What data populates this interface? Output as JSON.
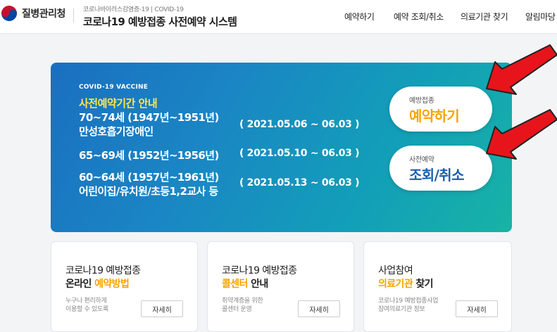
{
  "header": {
    "org_name": "질병관리청",
    "subtitle": "코로나바이러스감염증-19 | COVID-19",
    "title": "코로나19 예방접종 사전예약 시스템",
    "nav": [
      "예약하기",
      "예약 조회/취소",
      "의료기관 찾기",
      "알림마당"
    ]
  },
  "banner": {
    "tag": "COVID-19 VACCINE",
    "heading": "사전예약기간 안내",
    "line1": "70~74세 (1947년~1951년)",
    "line2": "만성호흡기장애인",
    "date1": "( 2021.05.06 ~ 06.03 )",
    "line3": "65~69세 (1952년~1956년)",
    "date2": "( 2021.05.10 ~ 06.03 )",
    "line4": "60~64세 (1957년~1961년)",
    "line5": "어린이집/유치원/초등1,2교사 등",
    "date3": "( 2021.05.13 ~ 06.03 )",
    "reserve_small": "예방접종",
    "reserve_big": "예약하기",
    "lookup_small": "사전예약",
    "lookup_big": "조회/취소"
  },
  "cards": [
    {
      "title1": "코로나19 예방접종",
      "title2_a": "온라인 ",
      "title2_b": "예약방법",
      "title2_c": "",
      "desc1": "누구나 편리하게",
      "desc2": "이용할 수 있도록",
      "button": "자세히"
    },
    {
      "title1": "코로나19 예방접종",
      "title2_a": "",
      "title2_b": "콜센터",
      "title2_c": " 안내",
      "desc1": "취약계층을 위한",
      "desc2": "콜센터 운영",
      "button": "자세히"
    },
    {
      "title1": "사업참여",
      "title2_a": "",
      "title2_b": "의료기관",
      "title2_c": " 찾기",
      "desc1": "코로나19 예방접종사업",
      "desc2": "참여의료기관 정보",
      "button": "자세히"
    }
  ],
  "colors": {
    "accent_yellow": "#f5a400",
    "highlight_yellow": "#ffe84a",
    "brand_blue": "#1b5fb0",
    "arrow_red": "#e8141b"
  }
}
